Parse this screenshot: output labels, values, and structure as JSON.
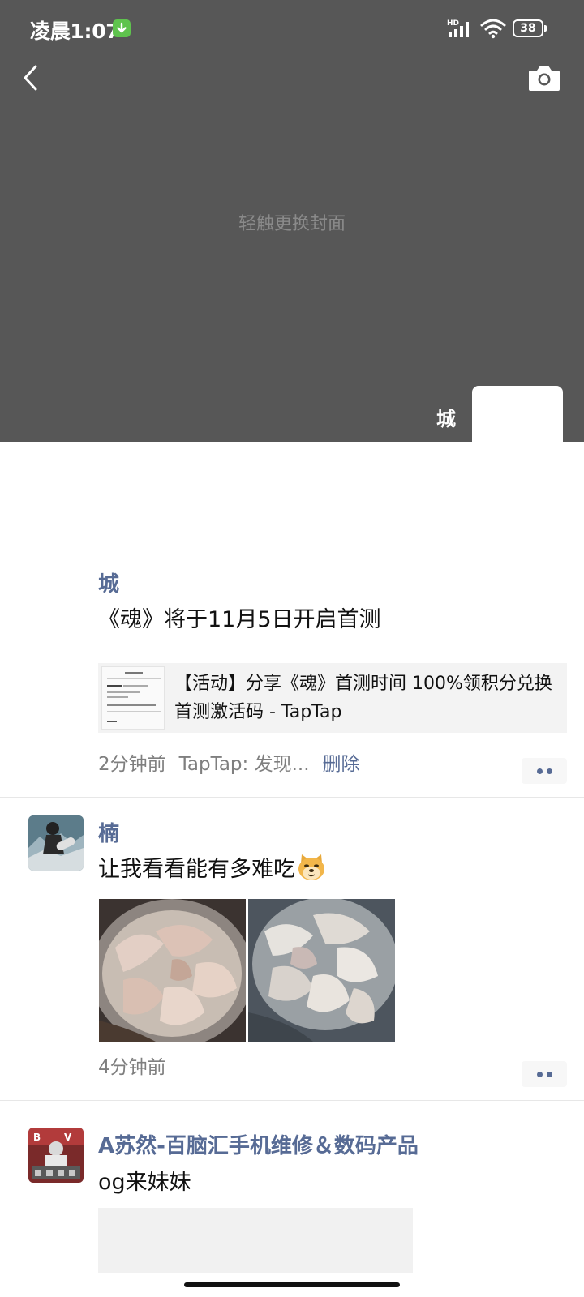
{
  "status_bar": {
    "time": "凌晨1:07",
    "network": "HD",
    "battery": "38"
  },
  "cover": {
    "hint": "轻触更换封面"
  },
  "profile": {
    "name": "城"
  },
  "posts": [
    {
      "author": "城",
      "text": "《魂》将于11月5日开启首测",
      "link_title": "【活动】分享《魂》首测时间 100%领积分兑换首测激活码 - TapTap",
      "time": "2分钟前",
      "source": "TapTap: 发现...",
      "delete_label": "删除"
    },
    {
      "author": "楠",
      "text": "让我看看能有多难吃",
      "time": "4分钟前"
    },
    {
      "author": "A苏然-百脑汇手机维修＆数码产品",
      "text": "og来妹妹"
    }
  ],
  "icons": {
    "back": "chevron-left-icon",
    "camera": "camera-icon",
    "more": "more-dots-icon",
    "emoji": "doge-emoji-icon"
  },
  "colors": {
    "accent": "#576b95",
    "cover": "#575757",
    "meta": "#7f7f7f"
  }
}
